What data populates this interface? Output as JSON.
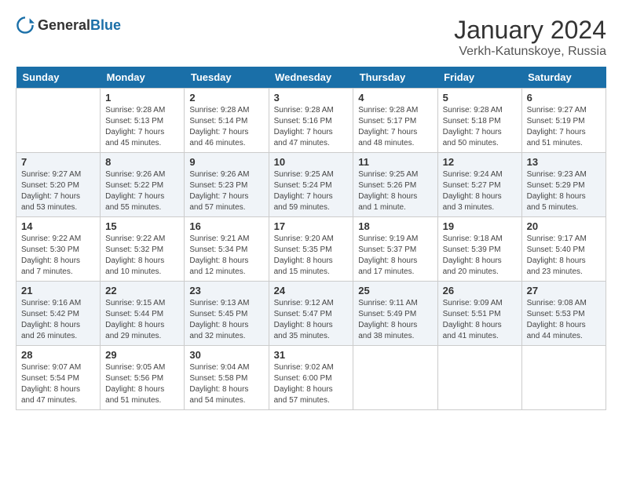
{
  "header": {
    "logo": {
      "text1": "General",
      "text2": "Blue"
    },
    "month": "January 2024",
    "location": "Verkh-Katunskoye, Russia"
  },
  "days_of_week": [
    "Sunday",
    "Monday",
    "Tuesday",
    "Wednesday",
    "Thursday",
    "Friday",
    "Saturday"
  ],
  "weeks": [
    [
      {
        "num": "",
        "info": ""
      },
      {
        "num": "1",
        "info": "Sunrise: 9:28 AM\nSunset: 5:13 PM\nDaylight: 7 hours\nand 45 minutes."
      },
      {
        "num": "2",
        "info": "Sunrise: 9:28 AM\nSunset: 5:14 PM\nDaylight: 7 hours\nand 46 minutes."
      },
      {
        "num": "3",
        "info": "Sunrise: 9:28 AM\nSunset: 5:16 PM\nDaylight: 7 hours\nand 47 minutes."
      },
      {
        "num": "4",
        "info": "Sunrise: 9:28 AM\nSunset: 5:17 PM\nDaylight: 7 hours\nand 48 minutes."
      },
      {
        "num": "5",
        "info": "Sunrise: 9:28 AM\nSunset: 5:18 PM\nDaylight: 7 hours\nand 50 minutes."
      },
      {
        "num": "6",
        "info": "Sunrise: 9:27 AM\nSunset: 5:19 PM\nDaylight: 7 hours\nand 51 minutes."
      }
    ],
    [
      {
        "num": "7",
        "info": "Sunrise: 9:27 AM\nSunset: 5:20 PM\nDaylight: 7 hours\nand 53 minutes."
      },
      {
        "num": "8",
        "info": "Sunrise: 9:26 AM\nSunset: 5:22 PM\nDaylight: 7 hours\nand 55 minutes."
      },
      {
        "num": "9",
        "info": "Sunrise: 9:26 AM\nSunset: 5:23 PM\nDaylight: 7 hours\nand 57 minutes."
      },
      {
        "num": "10",
        "info": "Sunrise: 9:25 AM\nSunset: 5:24 PM\nDaylight: 7 hours\nand 59 minutes."
      },
      {
        "num": "11",
        "info": "Sunrise: 9:25 AM\nSunset: 5:26 PM\nDaylight: 8 hours\nand 1 minute."
      },
      {
        "num": "12",
        "info": "Sunrise: 9:24 AM\nSunset: 5:27 PM\nDaylight: 8 hours\nand 3 minutes."
      },
      {
        "num": "13",
        "info": "Sunrise: 9:23 AM\nSunset: 5:29 PM\nDaylight: 8 hours\nand 5 minutes."
      }
    ],
    [
      {
        "num": "14",
        "info": "Sunrise: 9:22 AM\nSunset: 5:30 PM\nDaylight: 8 hours\nand 7 minutes."
      },
      {
        "num": "15",
        "info": "Sunrise: 9:22 AM\nSunset: 5:32 PM\nDaylight: 8 hours\nand 10 minutes."
      },
      {
        "num": "16",
        "info": "Sunrise: 9:21 AM\nSunset: 5:34 PM\nDaylight: 8 hours\nand 12 minutes."
      },
      {
        "num": "17",
        "info": "Sunrise: 9:20 AM\nSunset: 5:35 PM\nDaylight: 8 hours\nand 15 minutes."
      },
      {
        "num": "18",
        "info": "Sunrise: 9:19 AM\nSunset: 5:37 PM\nDaylight: 8 hours\nand 17 minutes."
      },
      {
        "num": "19",
        "info": "Sunrise: 9:18 AM\nSunset: 5:39 PM\nDaylight: 8 hours\nand 20 minutes."
      },
      {
        "num": "20",
        "info": "Sunrise: 9:17 AM\nSunset: 5:40 PM\nDaylight: 8 hours\nand 23 minutes."
      }
    ],
    [
      {
        "num": "21",
        "info": "Sunrise: 9:16 AM\nSunset: 5:42 PM\nDaylight: 8 hours\nand 26 minutes."
      },
      {
        "num": "22",
        "info": "Sunrise: 9:15 AM\nSunset: 5:44 PM\nDaylight: 8 hours\nand 29 minutes."
      },
      {
        "num": "23",
        "info": "Sunrise: 9:13 AM\nSunset: 5:45 PM\nDaylight: 8 hours\nand 32 minutes."
      },
      {
        "num": "24",
        "info": "Sunrise: 9:12 AM\nSunset: 5:47 PM\nDaylight: 8 hours\nand 35 minutes."
      },
      {
        "num": "25",
        "info": "Sunrise: 9:11 AM\nSunset: 5:49 PM\nDaylight: 8 hours\nand 38 minutes."
      },
      {
        "num": "26",
        "info": "Sunrise: 9:09 AM\nSunset: 5:51 PM\nDaylight: 8 hours\nand 41 minutes."
      },
      {
        "num": "27",
        "info": "Sunrise: 9:08 AM\nSunset: 5:53 PM\nDaylight: 8 hours\nand 44 minutes."
      }
    ],
    [
      {
        "num": "28",
        "info": "Sunrise: 9:07 AM\nSunset: 5:54 PM\nDaylight: 8 hours\nand 47 minutes."
      },
      {
        "num": "29",
        "info": "Sunrise: 9:05 AM\nSunset: 5:56 PM\nDaylight: 8 hours\nand 51 minutes."
      },
      {
        "num": "30",
        "info": "Sunrise: 9:04 AM\nSunset: 5:58 PM\nDaylight: 8 hours\nand 54 minutes."
      },
      {
        "num": "31",
        "info": "Sunrise: 9:02 AM\nSunset: 6:00 PM\nDaylight: 8 hours\nand 57 minutes."
      },
      {
        "num": "",
        "info": ""
      },
      {
        "num": "",
        "info": ""
      },
      {
        "num": "",
        "info": ""
      }
    ]
  ]
}
